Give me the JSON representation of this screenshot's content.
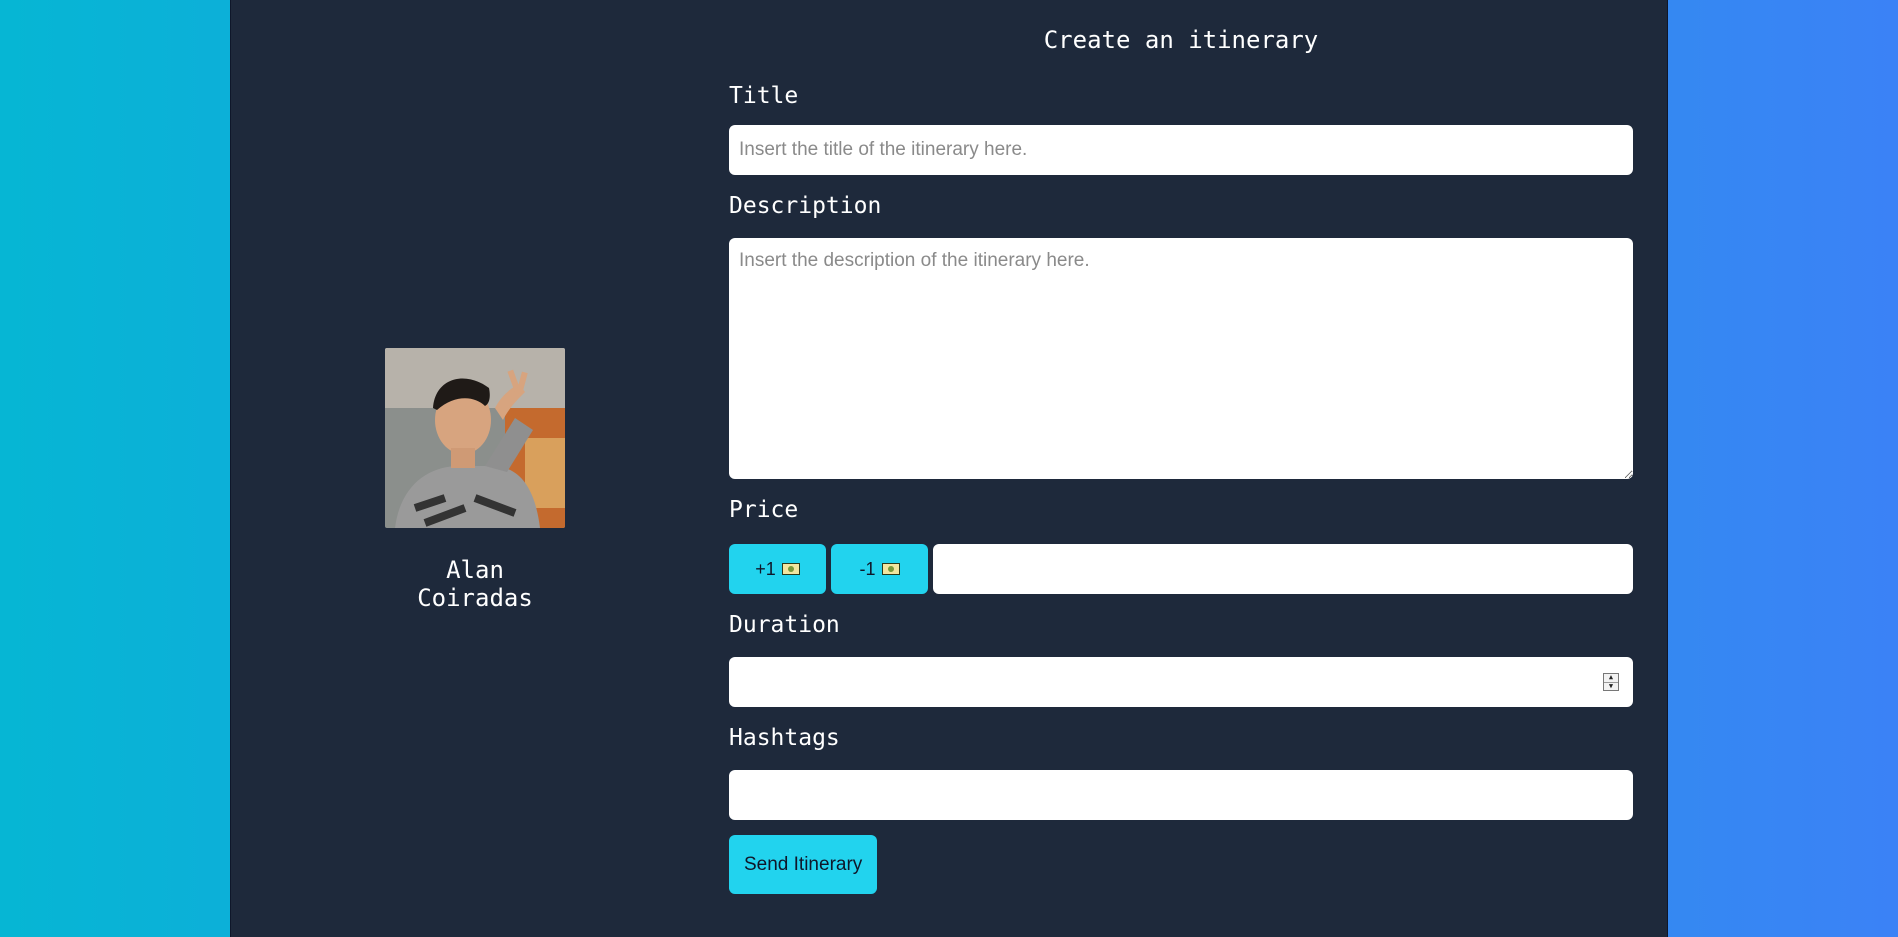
{
  "form": {
    "heading": "Create an itinerary",
    "title_label": "Title",
    "title_placeholder": "Insert the title of the itinerary here.",
    "description_label": "Description",
    "description_placeholder": "Insert the description of the itinerary here.",
    "price_label": "Price",
    "price_increment_label": "+1",
    "price_decrement_label": "-1",
    "price_value": "",
    "duration_label": "Duration",
    "duration_value": "",
    "hashtags_label": "Hashtags",
    "hashtags_value": "",
    "submit_label": "Send Itinerary"
  },
  "profile": {
    "name": "Alan Coiradas"
  },
  "icons": {
    "price_button_icon": "money-bill-icon",
    "duration_spinner": "spinner-arrows-icon"
  },
  "colors": {
    "background_gradient_start": "#06b6d4",
    "background_gradient_end": "#3b82f6",
    "panel": "#1e293b",
    "button_accent": "#22d3ee"
  }
}
